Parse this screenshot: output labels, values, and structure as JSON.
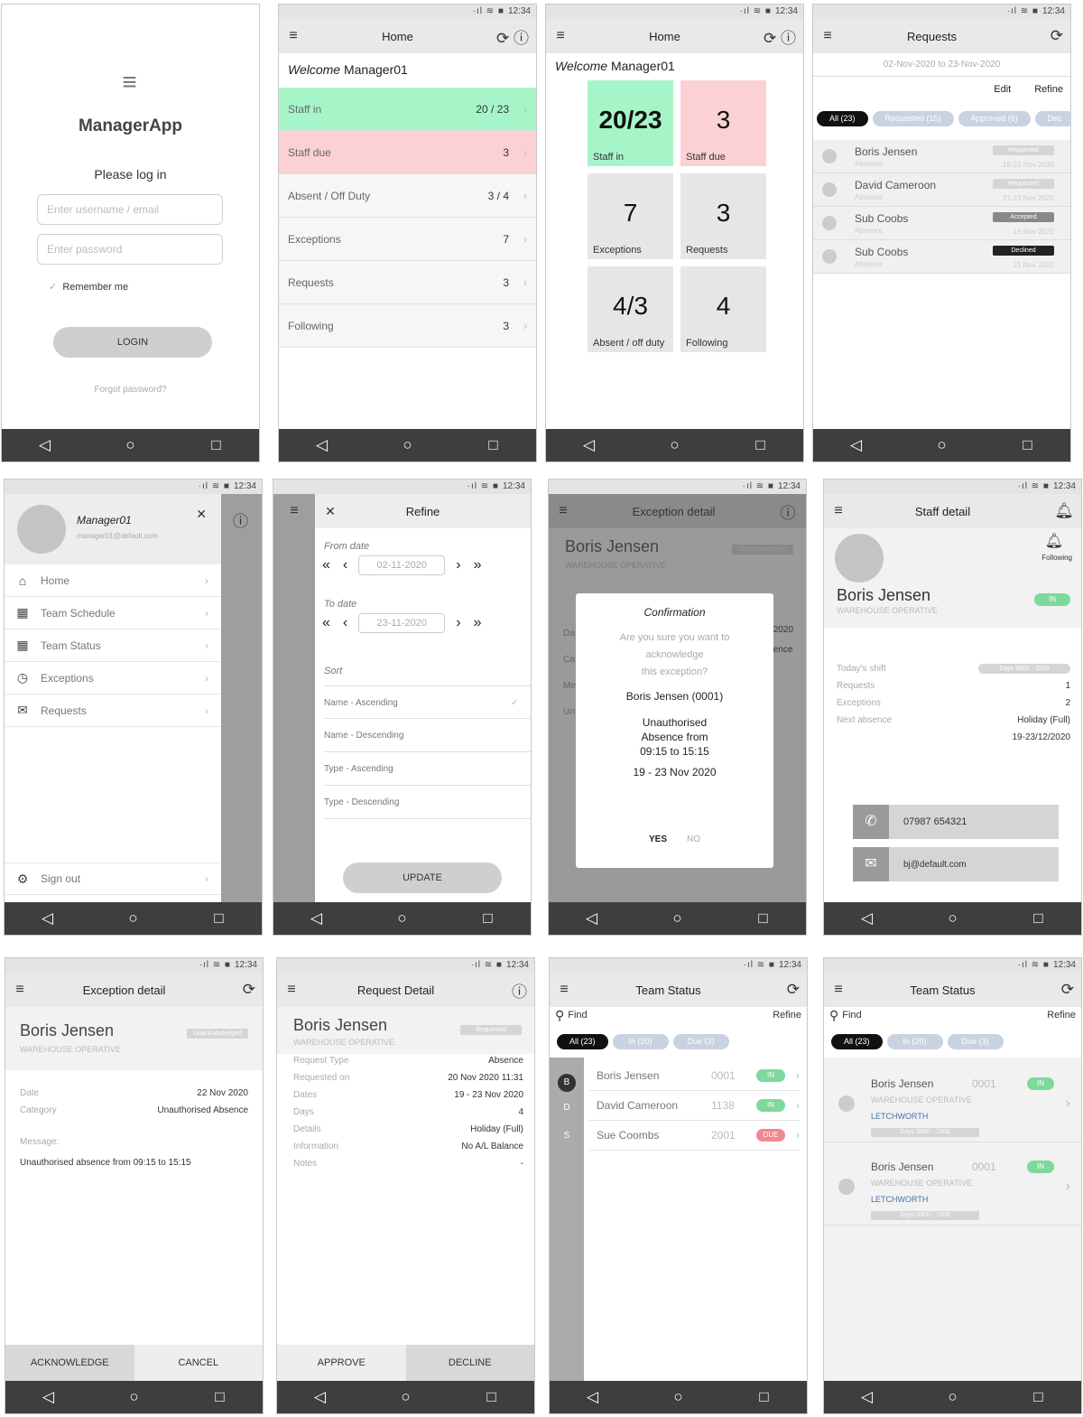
{
  "status_time": "12:34",
  "status_signal": "·ıl ≋ ■",
  "nav": {
    "back": "◁",
    "home": "○",
    "recent": "□"
  },
  "s1": {
    "logo_glyph": "≡",
    "brand": "ManagerApp",
    "please": "Please log in",
    "username_placeholder": "Enter username / email",
    "password_placeholder": "Enter password",
    "remember": "Remember me",
    "login": "LOGIN",
    "forgot": "Forgot password?"
  },
  "s2": {
    "title": "Home",
    "welcome_italic": "Welcome",
    "welcome_name": "Manager01",
    "rows": [
      {
        "label": "Staff in",
        "value": "20 / 23"
      },
      {
        "label": "Staff due",
        "value": "3"
      },
      {
        "label": "Absent / Off Duty",
        "value": "3 / 4"
      },
      {
        "label": "Exceptions",
        "value": "7"
      },
      {
        "label": "Requests",
        "value": "3"
      },
      {
        "label": "Following",
        "value": "3"
      }
    ]
  },
  "s3": {
    "title": "Home",
    "welcome_italic": "Welcome",
    "welcome_name": "Manager01",
    "tiles": [
      {
        "big": "20/23",
        "small": "Staff in"
      },
      {
        "big": "3",
        "small": "Staff due"
      },
      {
        "big": "7",
        "small": "Exceptions"
      },
      {
        "big": "3",
        "small": "Requests"
      },
      {
        "big": "4/3",
        "small": "Absent / off duty"
      },
      {
        "big": "4",
        "small": "Following"
      }
    ]
  },
  "s4": {
    "title": "Requests",
    "range": "02-Nov-2020 to 23-Nov-2020",
    "edit": "Edit",
    "refine": "Refine",
    "chips": [
      "All (23)",
      "Requested (15)",
      "Approved (6)",
      "Dec"
    ],
    "items": [
      {
        "name": "Boris Jensen",
        "sub": "Absence",
        "status": "Requested",
        "date": "19-23 Nov 2020"
      },
      {
        "name": "David Cameroon",
        "sub": "Absence",
        "status": "Requested",
        "date": "21-23 Nov 2020"
      },
      {
        "name": "Sub Coobs",
        "sub": "Absence",
        "status": "Accepted",
        "date": "19 Nov 2020"
      },
      {
        "name": "Sub Coobs",
        "sub": "Absence",
        "status": "Declined",
        "date": "21 Nov 2020"
      }
    ]
  },
  "s5": {
    "name": "Manager01",
    "email": "manager01@default.com",
    "items": [
      "Home",
      "Team Schedule",
      "Team Status",
      "Exceptions",
      "Requests"
    ],
    "signout": "Sign out"
  },
  "s6": {
    "title": "Refine",
    "from": "From date",
    "from_val": "02-11-2020",
    "to": "To date",
    "to_val": "23-11-2020",
    "sort": "Sort",
    "sorts": [
      "Name - Ascending",
      "Name - Descending",
      "Type - Ascending",
      "Type - Descending"
    ],
    "update": "UPDATE"
  },
  "s7": {
    "title": "Exception detail",
    "name": "Boris Jensen",
    "role": "WAREHOUSE OPERATIVE",
    "badge": "Unacknowledged",
    "peek": [
      "Da",
      "Ca",
      "Me",
      "Un",
      "2020",
      "ence"
    ],
    "dlg_title": "Confirmation",
    "dlg_q1": "Are you sure you want to",
    "dlg_q2": "acknowledge",
    "dlg_q3": "this exception?",
    "dlg_person": "Boris Jensen (0001)",
    "dlg_l1": "Unauthorised",
    "dlg_l2": "Absence from",
    "dlg_l3": "09:15 to 15:15",
    "dlg_dates": "19 - 23 Nov 2020",
    "yes": "YES",
    "no": "NO"
  },
  "s8": {
    "title": "Staff detail",
    "following": "Following",
    "name": "Boris Jensen",
    "role": "WAREHOUSE OPERATIVE",
    "in": "IN",
    "shift_k": "Today's shift",
    "shift_v": "Days 0800 - 1500",
    "rows": [
      {
        "k": "Requests",
        "v": "1"
      },
      {
        "k": "Exceptions",
        "v": "2"
      },
      {
        "k": "Next absence",
        "v": "Holiday (Full)"
      }
    ],
    "absence_dates": "19-23/12/2020",
    "phone": "07987 654321",
    "email": "bj@default.com"
  },
  "s9": {
    "title": "Exception detail",
    "name": "Boris Jensen",
    "role": "WAREHOUSE OPERATIVE",
    "badge": "Unacknowledged",
    "rows": [
      {
        "k": "Date",
        "v": "22 Nov 2020"
      },
      {
        "k": "Category",
        "v": "Unauthorised Absence"
      }
    ],
    "message_k": "Message:",
    "message": "Unauthorised absence from 09:15 to 15:15",
    "ack": "ACKNOWLEDGE",
    "cancel": "CANCEL"
  },
  "s10": {
    "title": "Request Detail",
    "name": "Boris Jensen",
    "role": "WAREHOUSE OPERATIVE",
    "badge": "Requested",
    "rows": [
      {
        "k": "Request Type",
        "v": "Absence"
      },
      {
        "k": "Requested on",
        "v": "20 Nov 2020 11:31"
      },
      {
        "k": "Dates",
        "v": "19 - 23 Nov 2020"
      },
      {
        "k": "Days",
        "v": "4"
      },
      {
        "k": "Details",
        "v": "Holiday (Full)"
      },
      {
        "k": "Information",
        "v": "No A/L Balance"
      },
      {
        "k": "Notes",
        "v": "-"
      }
    ],
    "approve": "APPROVE",
    "decline": "DECLINE"
  },
  "s11": {
    "title": "Team Status",
    "find": "Find",
    "refine": "Refine",
    "chips": [
      "All (23)",
      "In (20)",
      "Due (3)"
    ],
    "letters": [
      "B",
      "D",
      "S"
    ],
    "rows": [
      {
        "name": "Boris Jensen",
        "id": "0001",
        "st": "IN"
      },
      {
        "name": "David Cameroon",
        "id": "1138",
        "st": "IN"
      },
      {
        "name": "Sue Coombs",
        "id": "2001",
        "st": "DUE"
      }
    ]
  },
  "s12": {
    "title": "Team Status",
    "find": "Find",
    "refine": "Refine",
    "chips": [
      "All (23)",
      "In (20)",
      "Due (3)"
    ],
    "cards": [
      {
        "name": "Boris Jensen",
        "id": "0001",
        "role": "WAREHOUSE OPERATIVE",
        "site": "LETCHWORTH",
        "shift": "Days 0800 - 1500",
        "st": "IN"
      },
      {
        "name": "Boris Jensen",
        "id": "0001",
        "role": "WAREHOUSE OPERATIVE",
        "site": "LETCHWORTH",
        "shift": "Days 0800 - 1500",
        "st": "IN"
      }
    ]
  }
}
